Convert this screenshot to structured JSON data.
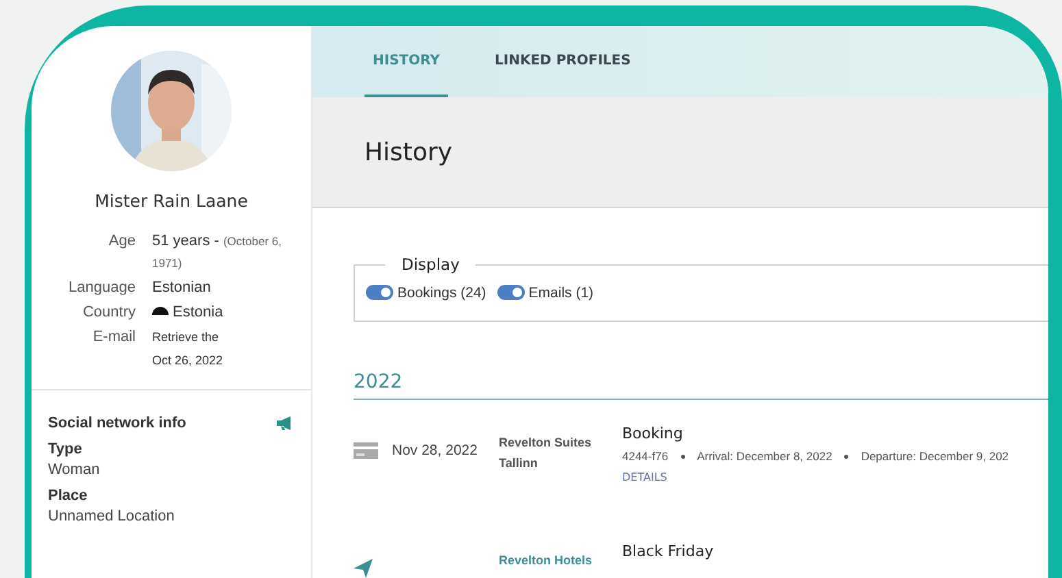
{
  "profile": {
    "name": "Mister Rain Laane",
    "details": [
      {
        "label": "Age",
        "value": "51 years - ",
        "note": "(October 6, 1971)"
      },
      {
        "label": "Language",
        "value": "Estonian"
      },
      {
        "label": "Country",
        "value": "Estonia",
        "flag": true
      },
      {
        "label": "E-mail",
        "value": "Retrieve the\nOct 26, 2022",
        "small": true
      }
    ],
    "social": {
      "title": "Social network info",
      "fields": [
        {
          "label": "Type",
          "value": "Woman"
        },
        {
          "label": "Place",
          "value": "Unnamed Location"
        }
      ]
    }
  },
  "tabs": [
    {
      "label": "HISTORY",
      "selected": true
    },
    {
      "label": "LINKED PROFILES",
      "selected": false
    }
  ],
  "header": {
    "title": "History"
  },
  "display": {
    "title": "Display",
    "toggles": [
      {
        "label": "Bookings (24)",
        "on": true
      },
      {
        "label": "Emails (1)",
        "on": true
      }
    ]
  },
  "year": "2022",
  "entries": [
    {
      "kind": "booking",
      "date": "Nov 28, 2022",
      "hotel": "Revelton Suites Tallinn",
      "title": "Booking",
      "meta": [
        "4244-f76",
        "Arrival: December 8, 2022",
        "Departure: December 9, 202"
      ],
      "link": "DETAILS"
    },
    {
      "kind": "campaign",
      "hotel": "Revelton Hotels",
      "title": "Black Friday"
    }
  ]
}
